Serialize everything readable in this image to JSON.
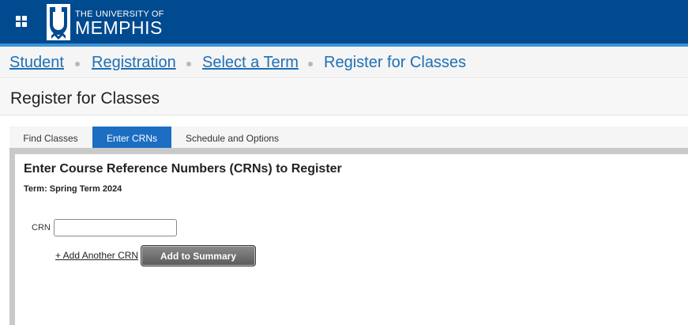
{
  "header": {
    "logo_small": "THE UNIVERSITY OF",
    "logo_big": "MEMPHIS",
    "colors": {
      "bar": "#004a8f",
      "stripe": "#3d92d6"
    }
  },
  "icons": {
    "app_menu": "grid-icon",
    "logo": "university-logo-icon"
  },
  "breadcrumb": {
    "items": [
      {
        "label": "Student",
        "link": true
      },
      {
        "label": "Registration",
        "link": true
      },
      {
        "label": "Select a Term",
        "link": true
      },
      {
        "label": "Register for Classes",
        "link": false
      }
    ]
  },
  "page": {
    "title": "Register for Classes"
  },
  "tabs": {
    "items": [
      {
        "label": "Find Classes",
        "active": false
      },
      {
        "label": "Enter CRNs",
        "active": true
      },
      {
        "label": "Schedule and Options",
        "active": false
      }
    ],
    "active_color": "#1b6ec2"
  },
  "crn_form": {
    "title": "Enter Course Reference Numbers (CRNs) to Register",
    "term": "Term: Spring Term 2024",
    "crn_label": "CRN",
    "crn_value": "",
    "add_link": "+ Add Another CRN",
    "submit_label": "Add to Summary"
  }
}
